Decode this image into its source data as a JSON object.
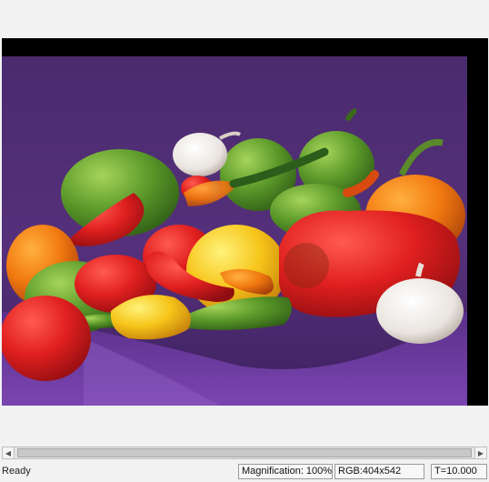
{
  "window": {
    "background": "#f2f2f2"
  },
  "image": {
    "description_icon": "image-display",
    "background_colors": {
      "cloth": "#4b2e73",
      "border": "#000000"
    }
  },
  "scrollbar": {
    "left_arrow": "◀",
    "right_arrow": "▶"
  },
  "status": {
    "message": "Ready",
    "magnification": "Magnification: 100%",
    "rgb": "RGB:404x542",
    "time": "T=10.000"
  }
}
